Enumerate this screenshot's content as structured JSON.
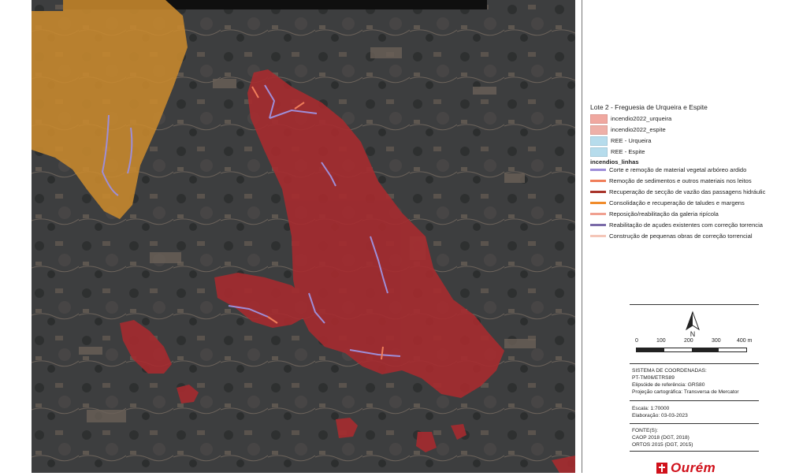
{
  "legend": {
    "title": "Lote 2 - Freguesia de Urqueira e Espite",
    "polygons": [
      {
        "label": "incendio2022_urqueira",
        "color": "#f0a8a0"
      },
      {
        "label": "incendio2022_espite",
        "color": "#eeb0a8"
      },
      {
        "label": "REE - Urqueira",
        "color": "#b6dcec"
      },
      {
        "label": "REE - Espite",
        "color": "#b6dcec"
      }
    ],
    "lines_group": "incendios_linhas",
    "lines": [
      {
        "label": "Corte e remoção de material vegetal arbóreo ardido",
        "color": "#9e8ed8"
      },
      {
        "label": "Remoção de sedimentos e outros materiais nos leitos",
        "color": "#f07e5a"
      },
      {
        "label": "Recuperação de secção de vazão das passagens hidráulic",
        "color": "#a8342a"
      },
      {
        "label": "Consolidação e recuperação de taludes e margens",
        "color": "#f08c2c"
      },
      {
        "label": "Reposição/reabilitação da galeria ripícola",
        "color": "#f0a090"
      },
      {
        "label": "Reabilitação de açudes existentes com correção torrencia",
        "color": "#7a6aa8"
      },
      {
        "label": "Construção de pequenas obras de correção torrencial",
        "color": "#f4c6b8"
      }
    ]
  },
  "north_label": "N",
  "scale": {
    "ticks": [
      "0",
      "100",
      "200",
      "300",
      "400 m"
    ]
  },
  "coords": {
    "heading": "SISTEMA DE COORDENADAS:",
    "system": "PT-TM06/ETRS89",
    "ellipsoid": "Elipsóide de referência: GRS80",
    "projection": "Projeção cartográfica: Transversa de Mercator"
  },
  "meta": {
    "scale": "Escala: 1:70000",
    "date": "Elaboração:  03-03-2023"
  },
  "sources": {
    "heading": "FONTE(S):",
    "caop": "CAOP 2018 (DGT, 2018)",
    "ortos": "ORTOS 2015 (DGT, 2015)"
  },
  "logo": {
    "text": "Ourém"
  }
}
